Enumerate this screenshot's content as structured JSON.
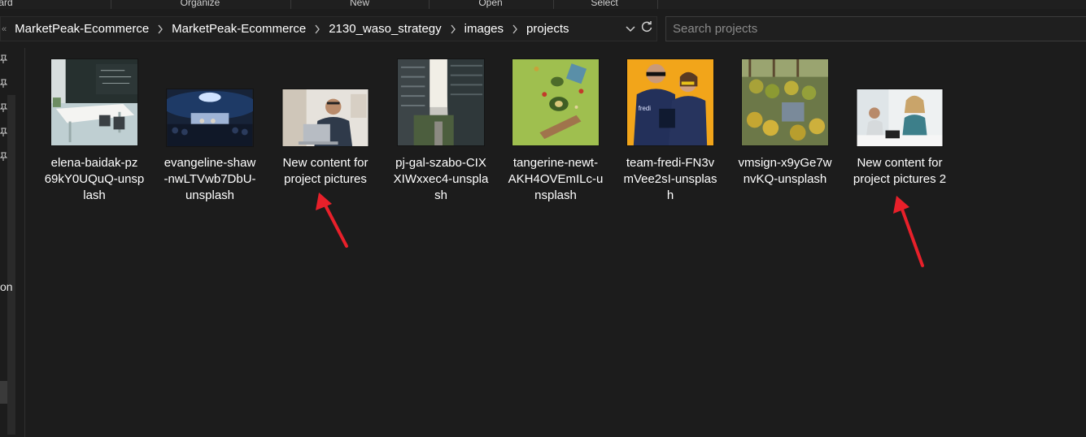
{
  "ribbon": {
    "groups": [
      "ard",
      "Organize",
      "New",
      "Open",
      "Select"
    ]
  },
  "address": {
    "crumbs": [
      "MarketPeak-Ecommerce",
      "MarketPeak-Ecommerce",
      "2130_waso_strategy",
      "images",
      "projects"
    ],
    "chevron_left_icon": "chevron-left-double-icon",
    "dropdown_icon": "chevron-down-icon",
    "refresh_icon": "refresh-icon"
  },
  "search": {
    "placeholder": "Search projects",
    "value": ""
  },
  "nav": {
    "partial_label": "on",
    "pin_icons": 5
  },
  "files": [
    {
      "name": "elena-baidak-pz69kY0UQuQ-unsplash",
      "line1": "elena-baidak-pz",
      "line2": "69kY0UQuQ-unsp",
      "line3": "lash",
      "thumb": "office"
    },
    {
      "name": "evangeline-shaw-nwLTVwb7DbU-unsplash",
      "line1": "evangeline-shaw",
      "line2": "-nwLTVwb7DbU-",
      "line3": "unsplash",
      "thumb": "conference"
    },
    {
      "name": "New content for project pictures",
      "line1": "New content for",
      "line2": "project pictures",
      "line3": "",
      "thumb": "laptop-man"
    },
    {
      "name": "pj-gal-szabo-CIXXIWxxec4-unsplash",
      "line1": "pj-gal-szabo-CIX",
      "line2": "XIWxxec4-unspla",
      "line3": "sh",
      "thumb": "street"
    },
    {
      "name": "tangerine-newt-AKH4OVEmILc-unsplash",
      "line1": "tangerine-newt-",
      "line2": "AKH4OVEmILc-u",
      "line3": "nsplash",
      "thumb": "food"
    },
    {
      "name": "team-fredi-FN3vmVee2sI-unsplash",
      "line1": "team-fredi-FN3v",
      "line2": "mVee2sI-unsplas",
      "line3": "h",
      "thumb": "couple"
    },
    {
      "name": "vmsign-x9yGe7wnvKQ-unsplash",
      "line1": "vmsign-x9yGe7w",
      "line2": "nvKQ-unsplash",
      "line3": "",
      "thumb": "market"
    },
    {
      "name": "New content for project pictures 2",
      "line1": "New content for",
      "line2": "project pictures 2",
      "line3": "",
      "thumb": "meeting"
    }
  ],
  "colors": {
    "background": "#1c1c1c",
    "annotation_arrow": "#e8202a",
    "text": "#ffffff"
  }
}
